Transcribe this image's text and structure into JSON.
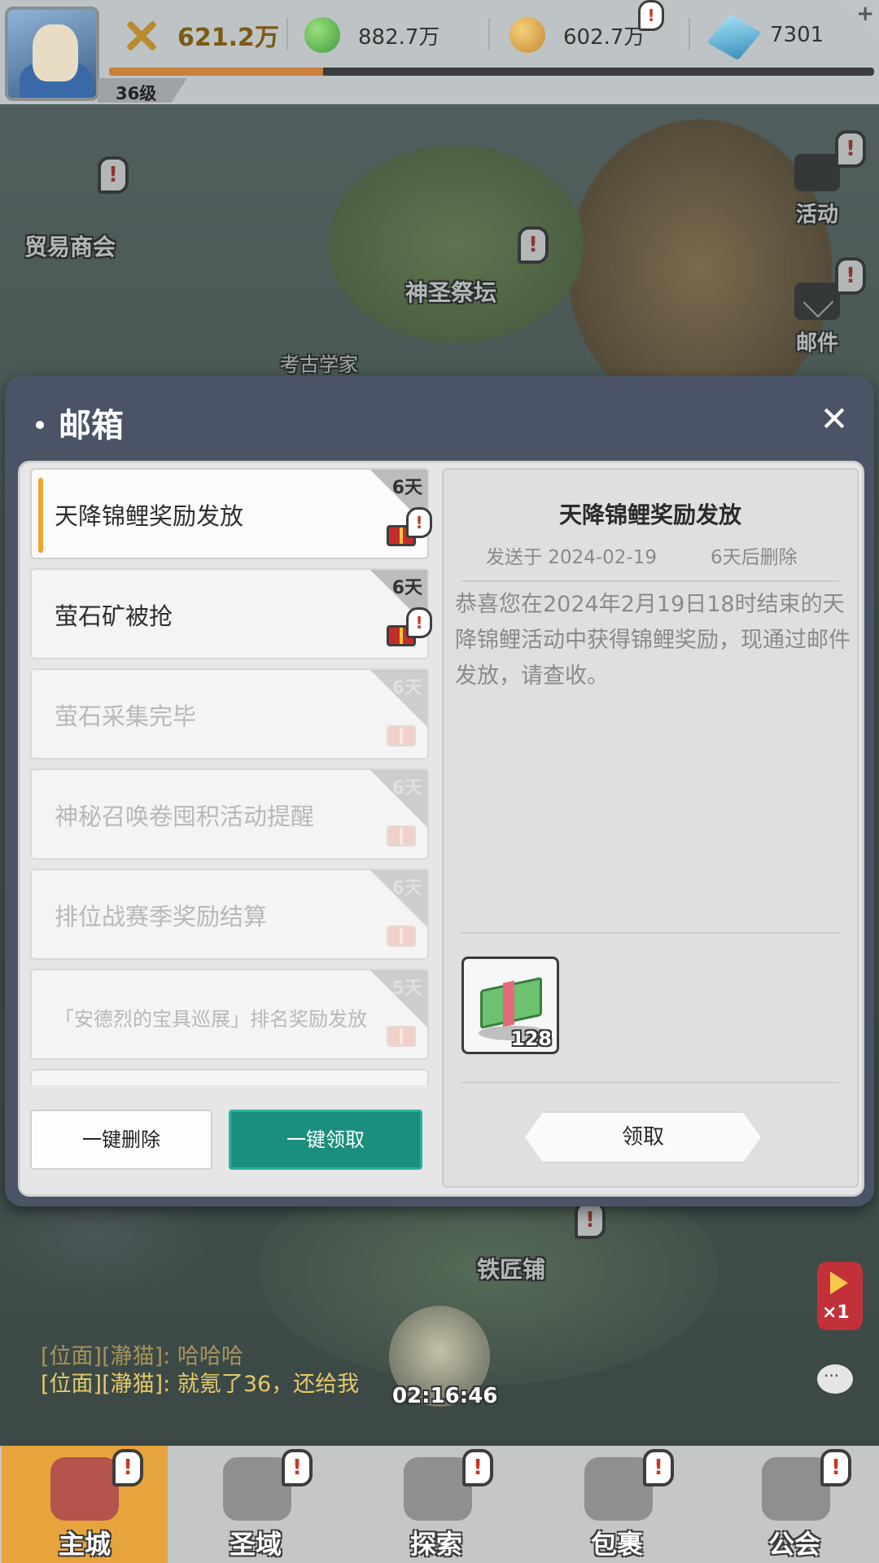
{
  "hud": {
    "power": "621.2万",
    "green_currency": "882.7万",
    "gold_currency": "602.7万",
    "diamonds": "7301",
    "level": "36级",
    "xp_progress": 0.28
  },
  "map": {
    "trade_guild": "贸易商会",
    "holy_altar": "神圣祭坛",
    "archaeologist": "考古学家",
    "blacksmith": "铁匠铺",
    "activity": "活动",
    "mail": "邮件"
  },
  "mailbox": {
    "title": "邮箱",
    "mails": [
      {
        "subject": "天降锦鲤奖励发放",
        "days": "6天",
        "unread": true,
        "active": true
      },
      {
        "subject": "萤石矿被抢",
        "days": "6天",
        "unread": true,
        "active": false
      },
      {
        "subject": "萤石采集完毕",
        "days": "6天",
        "unread": false,
        "active": false
      },
      {
        "subject": "神秘召唤卷囤积活动提醒",
        "days": "6天",
        "unread": false,
        "active": false
      },
      {
        "subject": "排位战赛季奖励结算",
        "days": "6天",
        "unread": false,
        "active": false
      },
      {
        "subject": "「安德烈的宝具巡展」排名奖励发放",
        "days": "5天",
        "unread": false,
        "active": false
      }
    ],
    "delete_all": "一键删除",
    "claim_all": "一键领取",
    "detail": {
      "title": "天降锦鲤奖励发放",
      "sent": "发送于 2024-02-19",
      "expire": "6天后删除",
      "body": "恭喜您在2024年2月19日18时结束的天降锦鲤活动中获得锦鲤奖励，现通过邮件发放，请查收。",
      "reward_qty": "128",
      "claim": "领取"
    }
  },
  "chat": {
    "line1": "[位面][瀞猫]: 哈哈哈",
    "line2": "[位面][瀞猫]: 就氪了36，还给我"
  },
  "timer": "02:16:46",
  "speed": "×1",
  "nav": [
    "主城",
    "圣域",
    "探索",
    "包裹",
    "公会"
  ],
  "colors": {
    "accent_teal": "#1a8f7d",
    "unread_accent": "#f0a32d",
    "dialog_bg": "#4a5466",
    "nav_active": "#e8a43c"
  }
}
